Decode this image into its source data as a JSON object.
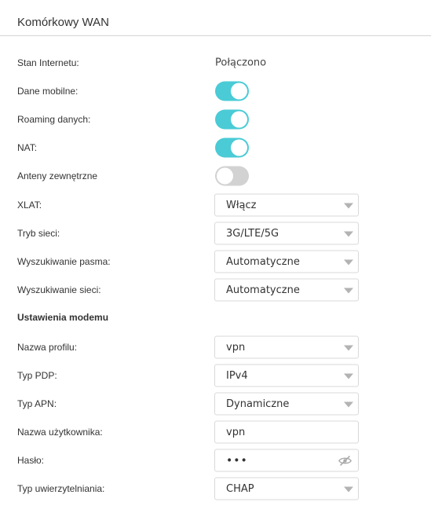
{
  "title": "Komórkowy WAN",
  "rows": {
    "internet_status": {
      "label": "Stan Internetu:",
      "value": "Połączono"
    },
    "mobile_data": {
      "label": "Dane mobilne:",
      "state": "on"
    },
    "data_roaming": {
      "label": "Roaming danych:",
      "state": "on"
    },
    "nat": {
      "label": "NAT:",
      "state": "on"
    },
    "external_antennas": {
      "label": "Anteny zewnętrzne",
      "state": "off"
    },
    "xlat": {
      "label": "XLAT:",
      "value": "Włącz"
    },
    "network_mode": {
      "label": "Tryb sieci:",
      "value": "3G/LTE/5G"
    },
    "band_search": {
      "label": "Wyszukiwanie pasma:",
      "value": "Automatyczne"
    },
    "network_search": {
      "label": "Wyszukiwanie sieci:",
      "value": "Automatyczne"
    }
  },
  "modem": {
    "section_title": "Ustawienia modemu",
    "profile_name": {
      "label": "Nazwa profilu:",
      "value": "vpn"
    },
    "pdp_type": {
      "label": "Typ PDP:",
      "value": "IPv4"
    },
    "apn_type": {
      "label": "Typ APN:",
      "value": "Dynamiczne"
    },
    "username": {
      "label": "Nazwa użytkownika:",
      "value": "vpn"
    },
    "password": {
      "label": "Hasło:",
      "value": "•••"
    },
    "auth_type": {
      "label": "Typ uwierzytelniania:",
      "value": "CHAP"
    }
  },
  "colors": {
    "toggle_on": "#4acbd6",
    "toggle_off": "#d2d2d2"
  }
}
